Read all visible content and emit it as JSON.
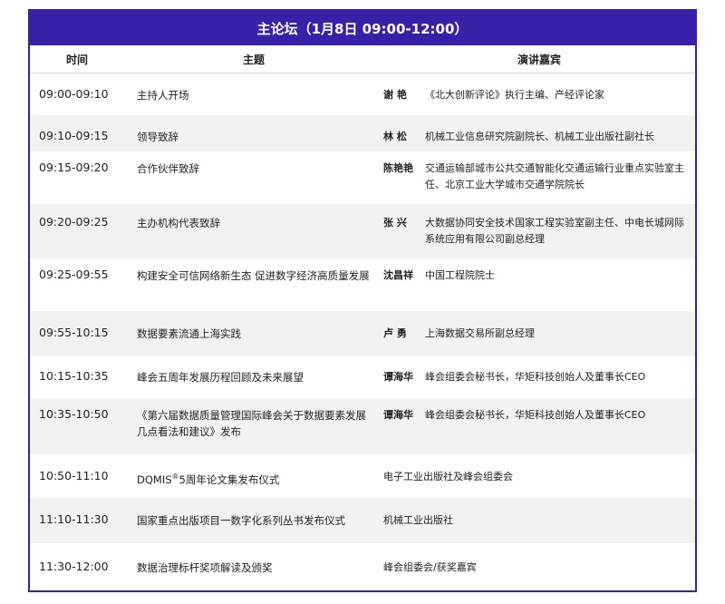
{
  "title": "主论坛（1月8日 09:00-12:00）",
  "headers": {
    "time": "时间",
    "topic": "主题",
    "speaker": "演讲嘉宾"
  },
  "rows": [
    {
      "time": "09:00-09:10",
      "topic": "主持人开场",
      "name": "谢 艳",
      "role": "《北大创新评论》执行主编、产经评论家"
    },
    {
      "time": "09:10-09:15",
      "topic": "领导致辞",
      "name": "林 松",
      "role": "机械工业信息研究院副院长、机械工业出版社副社长"
    },
    {
      "time": "09:15-09:20",
      "topic": "合作伙伴致辞",
      "name": "陈艳艳",
      "role": "交通运输部城市公共交通智能化交通运输行业重点实验室主任、北京工业大学城市交通学院院长"
    },
    {
      "time": "09:20-09:25",
      "topic": "主办机构代表致辞",
      "name": "张 兴",
      "role": "大数据协同安全技术国家工程实验室副主任、中电长城网际系统应用有限公司副总经理"
    },
    {
      "time": "09:25-09:55",
      "topic": "构建安全可信网络新生态 促进数字经济高质量发展",
      "name": "沈昌祥",
      "role": "中国工程院院士"
    },
    {
      "time": "09:55-10:15",
      "topic": "数据要素流通上海实践",
      "name": "卢 勇",
      "role": "上海数据交易所副总经理"
    },
    {
      "time": "10:15-10:35",
      "topic": "峰会五周年发展历程回顾及未来展望",
      "name": "谭海华",
      "role": "峰会组委会秘书长，华矩科技创始人及董事长CEO"
    },
    {
      "time": "10:35-10:50",
      "topic": "《第六届数据质量管理国际峰会关于数据要素发展几点看法和建议》发布",
      "name": "谭海华",
      "role": "峰会组委会秘书长，华矩科技创始人及董事长CEO"
    },
    {
      "time": "10:50-11:10",
      "topic": "DQMIS",
      "topic_sup": "®",
      "topic_rest": "5周年论文集发布仪式",
      "name": "",
      "role": "电子工业出版社及峰会组委会"
    },
    {
      "time": "11:10-11:30",
      "topic": "国家重点出版项目一数字化系列丛书发布仪式",
      "name": "",
      "role": "机械工业出版社"
    },
    {
      "time": "11:30-12:00",
      "topic": "数据治理标杆奖项解读及颁奖",
      "name": "",
      "role": "峰会组委会/获奖嘉宾"
    }
  ]
}
